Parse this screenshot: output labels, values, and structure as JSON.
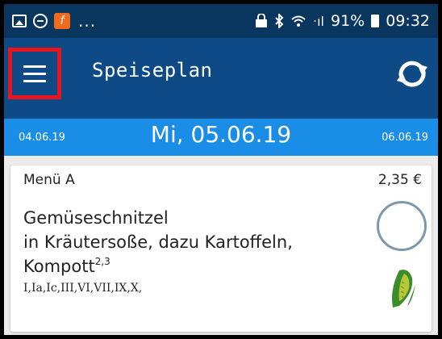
{
  "statusbar": {
    "dots": "...",
    "signal": "‧ıl",
    "battery": "91%",
    "time": "09:32"
  },
  "appbar": {
    "title": "Speiseplan"
  },
  "datebar": {
    "prev": "04.06.19",
    "current": "Mi, 05.06.19",
    "next": "06.06.19"
  },
  "card": {
    "menu": "Menü A",
    "price": "2,35 €",
    "line1": "Gemüseschnitzel",
    "line2": "in Kräutersoße, dazu Kartoffeln,",
    "line3": "Kompott",
    "superscript": "2,3",
    "additives": "I,Ia,Ic,III,VI,VII,IX,X,"
  },
  "colors": {
    "statusbar": "#08365e",
    "appbar": "#0d4a86",
    "datebar": "#1a8ee6",
    "highlight": "#e8141c",
    "circle": "#7d98aa",
    "corn": "#3c8d2a"
  },
  "icons": [
    "image-icon",
    "dnd-icon",
    "app-icon",
    "lock-icon",
    "bluetooth-icon",
    "wifi-icon",
    "signal-icon",
    "battery-icon",
    "menu-icon",
    "sync-icon",
    "status-circle-icon",
    "corn-icon"
  ]
}
